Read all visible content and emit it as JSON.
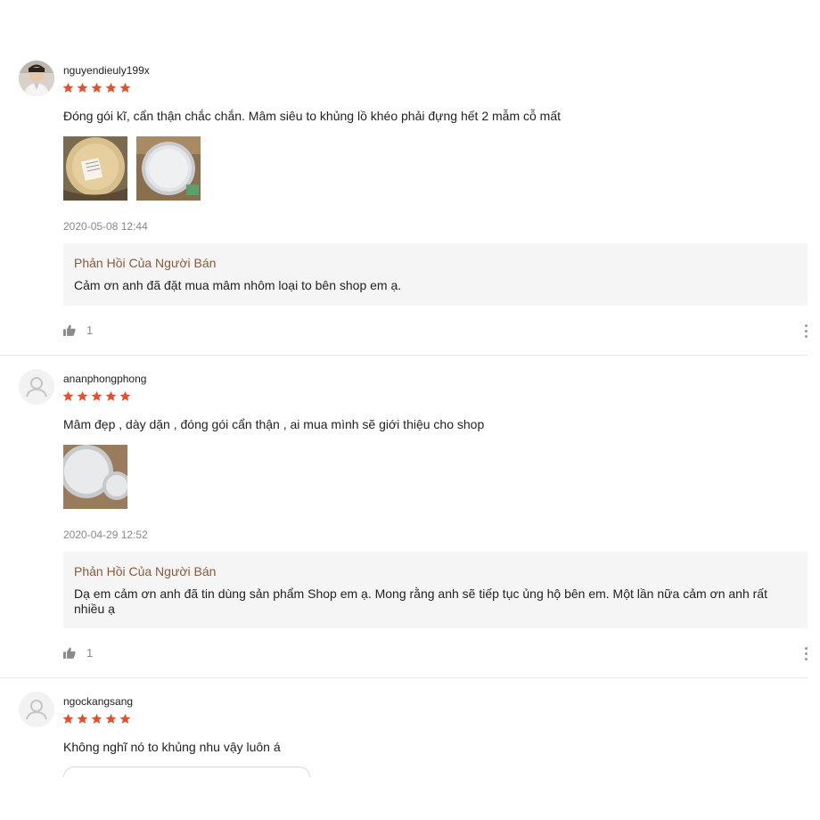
{
  "colors": {
    "star": "#ee4d2d",
    "reply_title": "#8a5a3a",
    "reply_bg": "#f5f5f5",
    "meta": "#888888"
  },
  "reviews": [
    {
      "username": "nguyendieuly199x",
      "rating": 5,
      "comment": "Đóng gói kĩ, cẩn thận chắc chắn. Mâm siêu to khủng lồ khéo phải đựng hết 2 mẫm cỗ mất",
      "date": "2020-05-08 12:44",
      "reply_title": "Phản Hồi Của Người Bán",
      "reply_text": "Cảm ơn anh đã đặt mua mâm nhôm loại to bên shop em ạ.",
      "likes": "1"
    },
    {
      "username": "ananphongphong",
      "rating": 5,
      "comment": "Mâm đẹp , dày dặn , đóng gói cẩn thận , ai mua mình sẽ giới thiệu cho shop",
      "date": "2020-04-29 12:52",
      "reply_title": "Phản Hồi Của Người Bán",
      "reply_text": "Dạ em cảm ơn anh đã tin dùng sản phẩm Shop em ạ. Mong rằng anh sẽ tiếp tục ủng hộ bên em. Một lần nữa cảm ơn anh rất nhiều ạ",
      "likes": "1"
    },
    {
      "username": "ngockangsang",
      "rating": 5,
      "comment": "Không nghĩ nó to khủng nhu vậy luôn á"
    }
  ]
}
